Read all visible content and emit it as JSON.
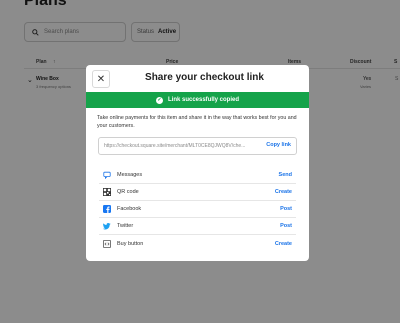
{
  "page": {
    "title": "Plans",
    "search_placeholder": "Search plans",
    "status_label": "Status",
    "status_value": "Active",
    "columns": [
      "Plan",
      "Price",
      "Items",
      "Discount",
      "S"
    ],
    "row": {
      "name": "Wine Box",
      "sub": "3 frequency options",
      "discount": "Yes",
      "discount_sub": "Varies"
    }
  },
  "modal": {
    "title": "Share your checkout link",
    "banner": "Link successfully copied",
    "description": "Take online payments for this item and share it in the way that works best for you and your customers.",
    "link_url": "https://checkout.square.site/merchant/MLT0CE8QJWQ8V/che...",
    "copy_label": "Copy link",
    "options": [
      {
        "label": "Messages",
        "action": "Send",
        "icon": "messages-icon"
      },
      {
        "label": "QR code",
        "action": "Create",
        "icon": "qr-code-icon"
      },
      {
        "label": "Facebook",
        "action": "Post",
        "icon": "facebook-icon"
      },
      {
        "label": "Twitter",
        "action": "Post",
        "icon": "twitter-icon"
      },
      {
        "label": "Buy button",
        "action": "Create",
        "icon": "code-icon"
      }
    ]
  },
  "colors": {
    "success": "#15a34a",
    "link": "#1a73e8",
    "facebook": "#1877f2",
    "twitter": "#1da1f2"
  }
}
